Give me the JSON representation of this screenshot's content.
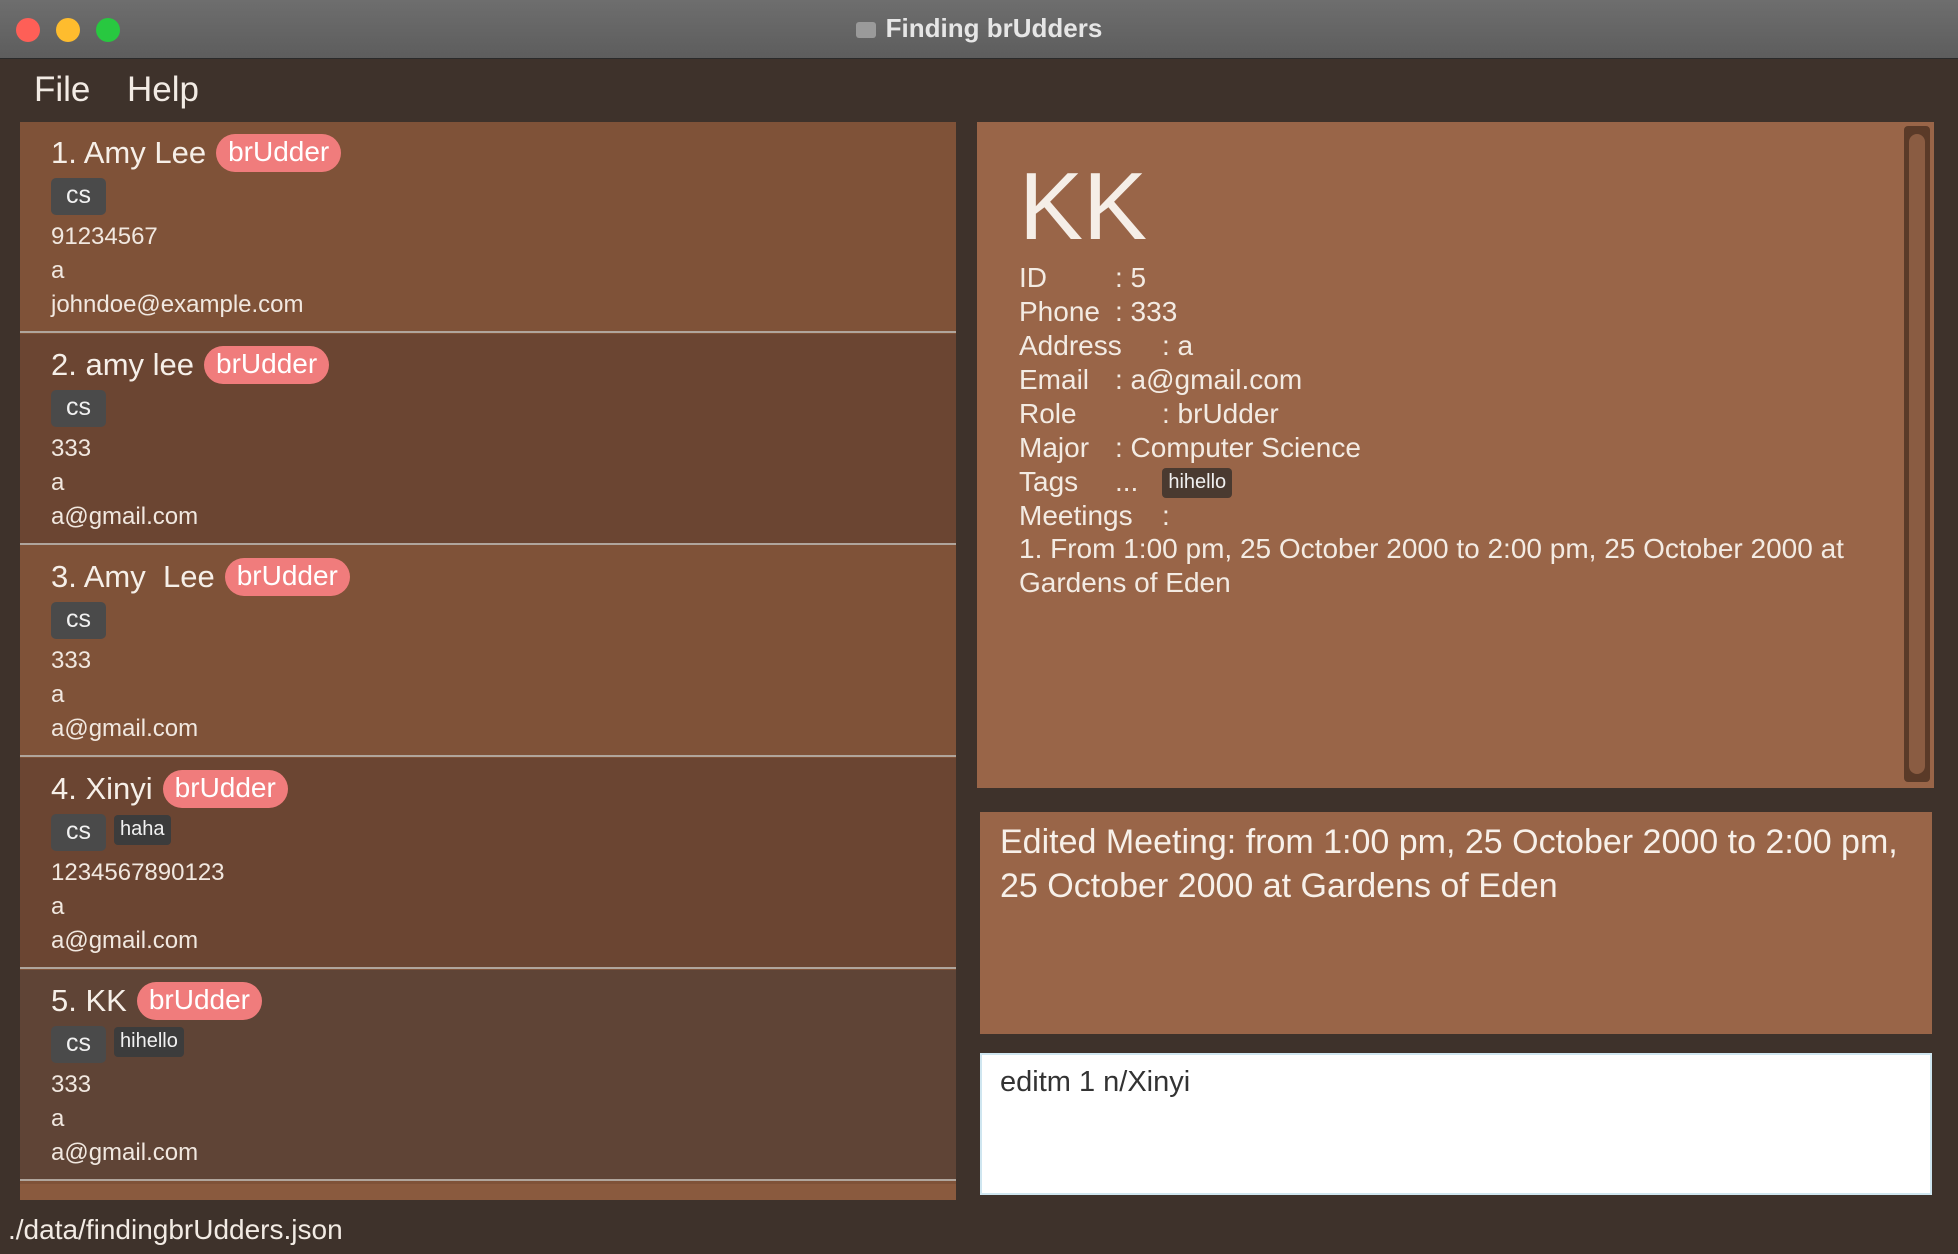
{
  "window": {
    "title": "Finding brUdders"
  },
  "menu": {
    "file": "File",
    "help": "Help"
  },
  "persons": [
    {
      "index_name": "1. Amy Lee",
      "role": "brUdder",
      "major_tag": "cs",
      "extra_tag": "",
      "phone": "91234567",
      "address": "a",
      "email": "johndoe@example.com",
      "bg": "#7f5238"
    },
    {
      "index_name": "2. amy lee",
      "role": "brUdder",
      "major_tag": "cs",
      "extra_tag": "",
      "phone": "333",
      "address": "a",
      "email": "a@gmail.com",
      "bg": "#6b4532"
    },
    {
      "index_name": "3. Amy  Lee",
      "role": "brUdder",
      "major_tag": "cs",
      "extra_tag": "",
      "phone": "333",
      "address": "a",
      "email": "a@gmail.com",
      "bg": "#7f5238"
    },
    {
      "index_name": "4. Xinyi",
      "role": "brUdder",
      "major_tag": "cs",
      "extra_tag": "haha",
      "phone": "1234567890123",
      "address": "a",
      "email": "a@gmail.com",
      "bg": "#6b4532"
    },
    {
      "index_name": "5. KK",
      "role": "brUdder",
      "major_tag": "cs",
      "extra_tag": "hihello",
      "phone": "333",
      "address": "a",
      "email": "a@gmail.com",
      "bg": "#5f4436"
    }
  ],
  "detail": {
    "name": "KK",
    "id_label": "ID",
    "id_value": ": 5",
    "phone_label": "Phone",
    "phone_value": ": 333",
    "address_label": "Address",
    "address_value": ": a",
    "email_label": "Email",
    "email_value": ": a@gmail.com",
    "role_label": "Role",
    "role_value": ": brUdder",
    "major_label": "Major",
    "major_value": ": Computer Science",
    "tags_label": "Tags",
    "tags_value": "...",
    "tag": "hihello",
    "meetings_label": "Meetings",
    "meetings_value": ":",
    "meeting_1": "1. From 1:00 pm, 25 October 2000 to 2:00 pm, 25 October 2000 at Gardens of Eden"
  },
  "result": {
    "text": "Edited Meeting: from 1:00 pm, 25 October 2000 to 2:00 pm, 25 October 2000 at Gardens of Eden"
  },
  "command": {
    "value": "editm 1 n/Xinyi"
  },
  "status": {
    "path": "./data/findingbrUdders.json"
  },
  "colors": {
    "accent_badge": "#f07c7c",
    "panel": "#996548",
    "background": "#3e322b"
  }
}
